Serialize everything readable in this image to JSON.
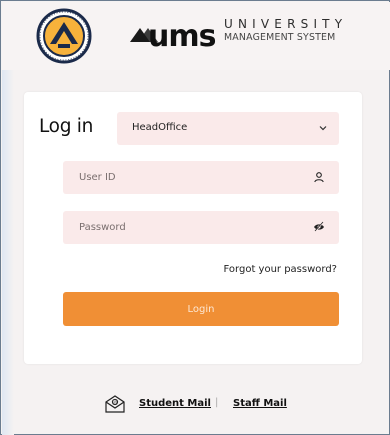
{
  "header": {
    "brand_name": "UMS",
    "tagline_line1": "UNIVERSITY",
    "tagline_line2": "MANAGEMENT SYSTEM"
  },
  "login": {
    "title": "Log in",
    "location_select": {
      "value": "HeadOffice"
    },
    "user_id": {
      "placeholder": "User ID",
      "value": ""
    },
    "password": {
      "placeholder": "Password",
      "value": ""
    },
    "forgot_label": "Forgot your password?",
    "submit_label": "Login"
  },
  "footer": {
    "student_mail": "Student Mail",
    "separator": "|",
    "staff_mail": "Staff Mail"
  },
  "colors": {
    "accent": "#f08f35",
    "field_bg": "#faeaea",
    "page_bg": "#f5f2f2",
    "card_bg": "#ffffff"
  }
}
